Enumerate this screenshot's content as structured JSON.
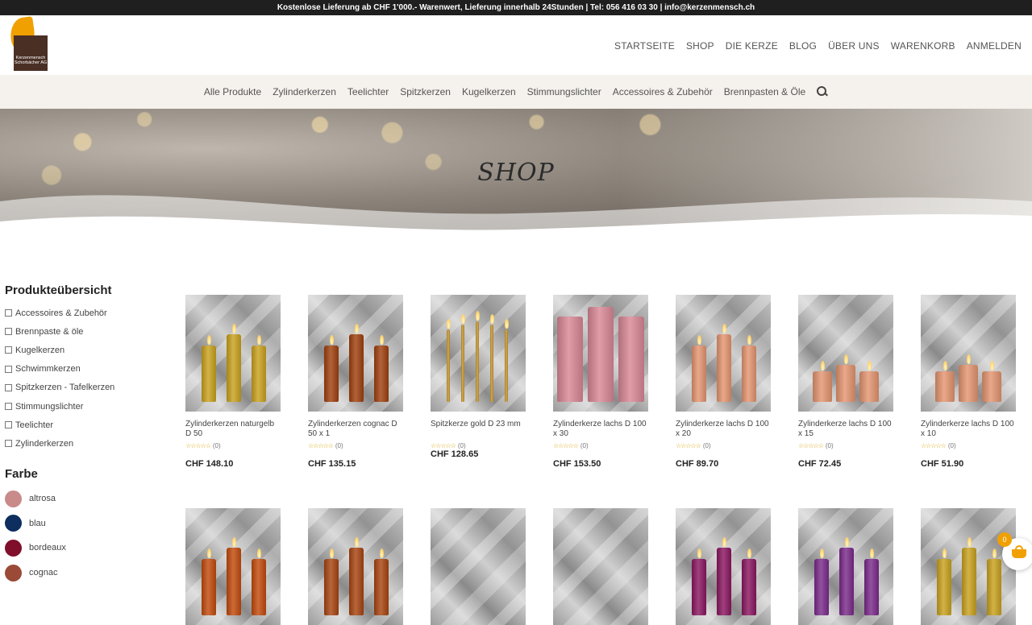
{
  "topbar": {
    "text": "Kostenlose Lieferung ab CHF 1'000.- Warenwert, Lieferung innerhalb 24Stunden | Tel: 056 416 03 30 | info@kerzenmensch.ch"
  },
  "logo": {
    "text": "Kerzenmensch Schorbächer AG"
  },
  "mainnav": [
    "STARTSEITE",
    "SHOP",
    "DIE KERZE",
    "BLOG",
    "ÜBER UNS",
    "WARENKORB",
    "ANMELDEN"
  ],
  "subnav": [
    "Alle Produkte",
    "Zylinderkerzen",
    "Teelichter",
    "Spitzkerzen",
    "Kugelkerzen",
    "Stimmungslichter",
    "Accessoires & Zubehör",
    "Brennpasten & Öle"
  ],
  "hero": {
    "title": "SHOP"
  },
  "sidebar": {
    "heading": "Produkteübersicht",
    "categories": [
      "Accessoires & Zubehör",
      "Brennpaste & öle",
      "Kugelkerzen",
      "Schwimmkerzen",
      "Spitzkerzen - Tafelkerzen",
      "Stimmungslichter",
      "Teelichter",
      "Zylinderkerzen"
    ],
    "farbe_heading": "Farbe",
    "colors": [
      {
        "label": "altrosa",
        "color": "#c98a8a"
      },
      {
        "label": "blau",
        "color": "#0d2e5e"
      },
      {
        "label": "bordeaux",
        "color": "#7f0f2a"
      },
      {
        "label": "cognac",
        "color": "#9a4a36"
      }
    ]
  },
  "products": [
    {
      "name": "Zylinderkerzen naturgelb D 50",
      "rating": "☆☆☆☆☆",
      "count": "(0)",
      "price": "CHF 148.10",
      "candle_color": "#c9a21e",
      "candle_type": "cyl3",
      "lit": true
    },
    {
      "name": "Zylinderkerzen cognac D 50 x 1",
      "rating": "☆☆☆☆☆",
      "count": "(0)",
      "price": "CHF 135.15",
      "candle_color": "#a0400e",
      "candle_type": "cyl3",
      "lit": true
    },
    {
      "name": "Spitzkerze gold D 23 mm",
      "rating": "☆☆☆☆☆",
      "count": "(0)",
      "price": "CHF 128.65",
      "candle_color": "#c6962e",
      "candle_type": "taper",
      "lit": true
    },
    {
      "name": "Zylinderkerze lachs D 100 x 30",
      "rating": "☆☆☆☆☆",
      "count": "(0)",
      "price": "CHF 153.50",
      "candle_color": "#d98896",
      "candle_type": "big3",
      "lit": false
    },
    {
      "name": "Zylinderkerze lachs D 100 x 20",
      "rating": "☆☆☆☆☆",
      "count": "(0)",
      "price": "CHF 89.70",
      "candle_color": "#e49570",
      "candle_type": "cyl3",
      "lit": true
    },
    {
      "name": "Zylinderkerze lachs D 100 x 15",
      "rating": "☆☆☆☆☆",
      "count": "(0)",
      "price": "CHF 72.45",
      "candle_color": "#e49570",
      "candle_type": "short3",
      "lit": true
    },
    {
      "name": "Zylinderkerze lachs D 100 x 10",
      "rating": "☆☆☆☆☆",
      "count": "(0)",
      "price": "CHF 51.90",
      "candle_color": "#e49570",
      "candle_type": "short3",
      "lit": true
    }
  ],
  "products_row2": [
    {
      "candle_color": "#c24a0c",
      "candle_type": "cyl3",
      "lit": true
    },
    {
      "candle_color": "#a84410",
      "candle_type": "cyl3",
      "lit": true
    },
    {
      "candle_color": "",
      "candle_type": "none",
      "lit": false
    },
    {
      "candle_color": "",
      "candle_type": "none",
      "lit": false
    },
    {
      "candle_color": "#8a1660",
      "candle_type": "cyl3",
      "lit": true
    },
    {
      "candle_color": "#7a2a8a",
      "candle_type": "cyl3",
      "lit": true
    },
    {
      "candle_color": "#c9a21e",
      "candle_type": "cyl3",
      "lit": true
    }
  ],
  "cart": {
    "count": "0"
  }
}
